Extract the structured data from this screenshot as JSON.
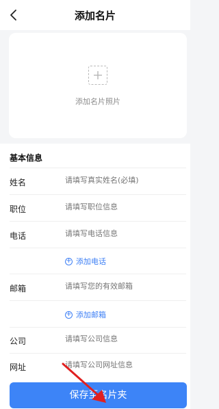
{
  "header": {
    "title": "添加名片",
    "back_icon": "chevron-left-icon"
  },
  "photo": {
    "caption": "添加名片照片",
    "icon": "plus-icon"
  },
  "form": {
    "section_title": "基本信息",
    "fields": {
      "name": {
        "label": "姓名",
        "placeholder": "请填写真实姓名(必填)"
      },
      "position": {
        "label": "职位",
        "placeholder": "请填写职位信息"
      },
      "phone": {
        "label": "电话",
        "placeholder": "请填写电话信息"
      },
      "email": {
        "label": "邮箱",
        "placeholder": "请填写您的有效邮箱"
      },
      "company": {
        "label": "公司",
        "placeholder": "请填写公司信息"
      },
      "website": {
        "label": "网址",
        "placeholder": "请填写公司网址信息"
      }
    },
    "add_phone": "添加电话",
    "add_email": "添加邮箱"
  },
  "save_button": "保存至名片夹",
  "colors": {
    "accent": "#3d84f7",
    "link": "#3d7ff5",
    "annotation_arrow": "#e02020"
  }
}
